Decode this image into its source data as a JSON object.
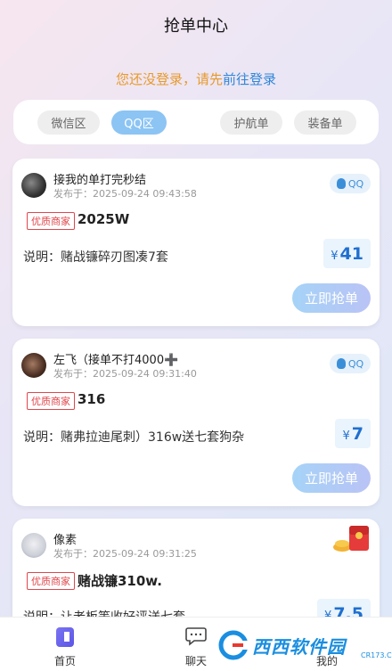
{
  "header": {
    "title": "抢单中心"
  },
  "login": {
    "text": "您还没登录，请先",
    "link": "前往登录"
  },
  "filters": [
    {
      "label": "微信区",
      "active": false
    },
    {
      "label": "QQ区",
      "active": true
    },
    {
      "label": "护航单",
      "active": false
    },
    {
      "label": "装备单",
      "active": false
    }
  ],
  "orders": [
    {
      "user": "接我的单打完秒结",
      "time": "发布于：2025-09-24 09:43:58",
      "platform": "QQ",
      "merchant_tag": "优质商家",
      "title": "2025W",
      "desc": "说明：赌战镰碎刃图凑7套",
      "currency": "¥",
      "price": "41",
      "button": "立即抢单"
    },
    {
      "user": "左飞（接单不打4000",
      "time": "发布于：2025-09-24 09:31:40",
      "platform": "QQ",
      "merchant_tag": "优质商家",
      "title": "316",
      "desc": "说明：赌弗拉迪尾刺）316w送七套狗杂",
      "currency": "¥",
      "price": "7",
      "button": "立即抢单"
    },
    {
      "user": "像素",
      "time": "发布于：2025-09-24 09:31:25",
      "merchant_tag": "优质商家",
      "title": "赌战镰310w.",
      "desc": "说明：让老板等收好评送七套",
      "currency": "¥",
      "price": "7.5"
    }
  ],
  "tabbar": {
    "home": "首页",
    "chat": "聊天",
    "mine": "我的"
  },
  "watermark": {
    "text": "西西软件园",
    "sub": "CR173.COM"
  },
  "colors": {
    "accent": "#8cc4f4",
    "price": "#1f6fcf",
    "merchant": "#e0474c",
    "login_warn": "#e89a2b"
  }
}
